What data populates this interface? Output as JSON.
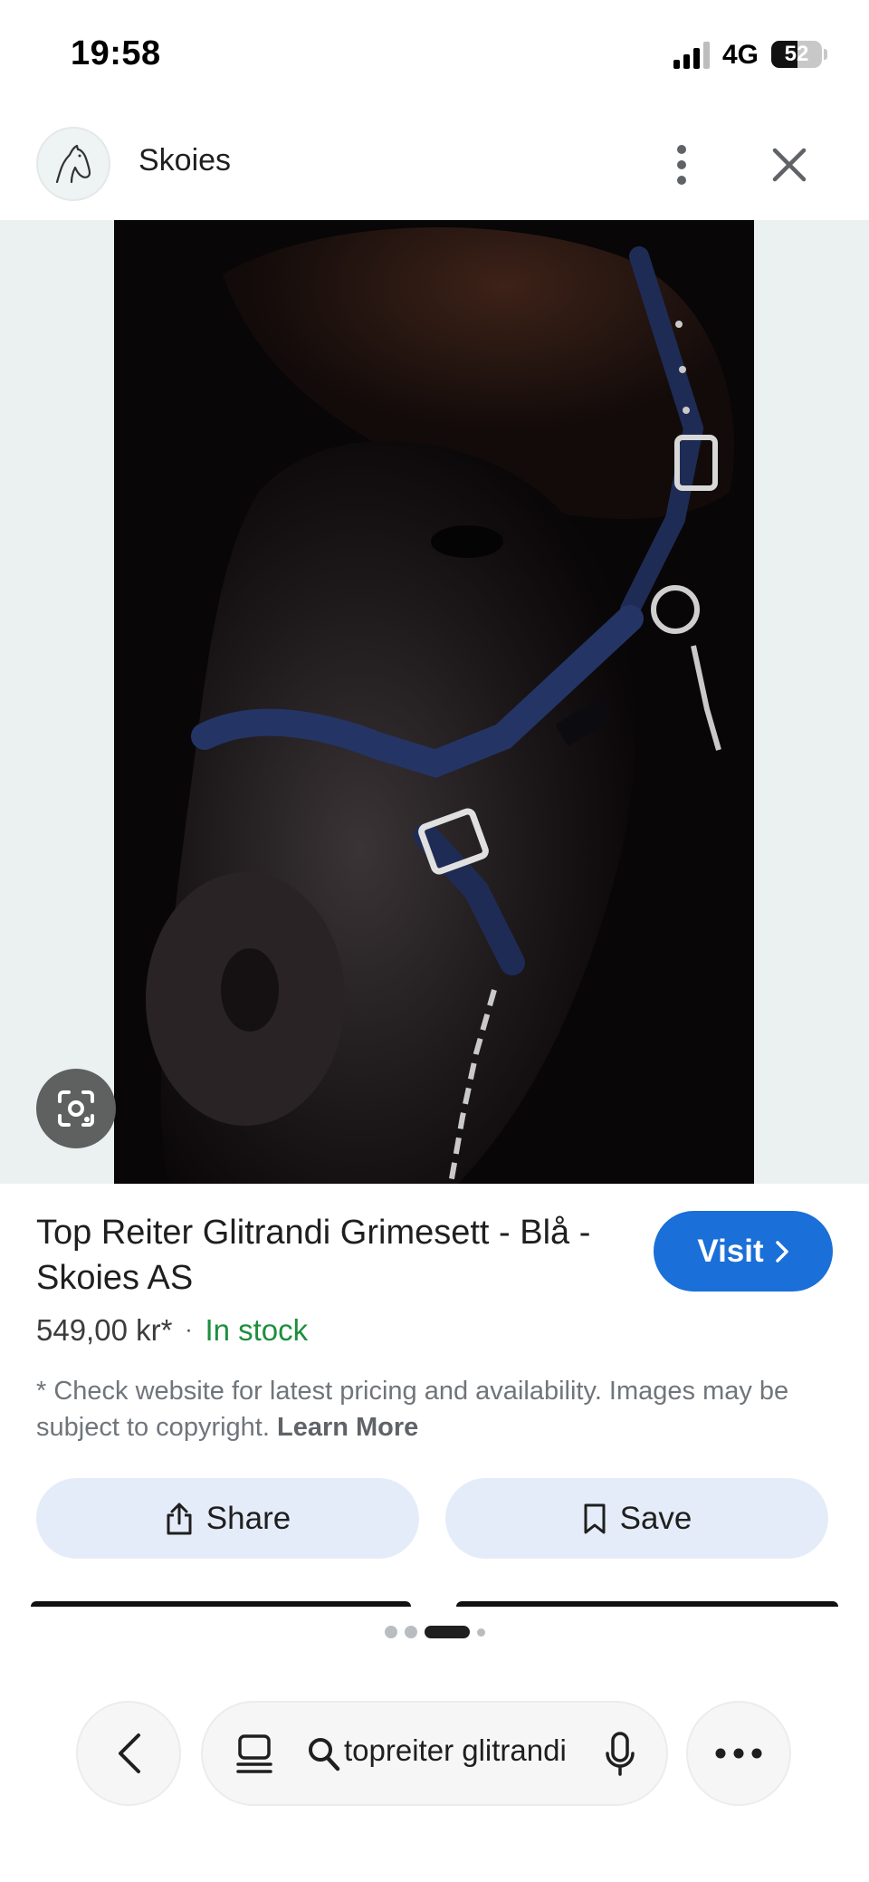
{
  "status_bar": {
    "time": "19:58",
    "network": "4G",
    "battery": "52",
    "battery_level": 0.52
  },
  "header": {
    "site_name": "Skoies",
    "logo_icon": "horse-head-icon",
    "more_icon": "more-vert-icon",
    "close_icon": "close-icon"
  },
  "image": {
    "lens_icon": "google-lens-icon"
  },
  "product": {
    "title": "Top Reiter Glitrandi Grimesett - Blå - Skoies AS",
    "price": "549,00 kr*",
    "separator": "·",
    "stock": "In stock",
    "disclaimer": "* Check website for latest pricing and availability. Images may be subject to copyright.",
    "learn_more": "Learn More"
  },
  "actions": {
    "visit_label": "Visit",
    "share_label": "Share",
    "save_label": "Save"
  },
  "pager": {
    "total": 4,
    "active_index": 2
  },
  "bottom_bar": {
    "query": "topreiter glitrandi",
    "back_icon": "chevron-left-icon",
    "tabs_icon": "tabs-icon",
    "search_icon": "search-icon",
    "mic_icon": "mic-icon",
    "more_icon": "more-horiz-icon"
  },
  "colors": {
    "accent": "#1a6fd8",
    "stock_green": "#1e8e3e",
    "action_bg": "#e5ecf9",
    "image_backdrop": "#ebf0f0"
  }
}
